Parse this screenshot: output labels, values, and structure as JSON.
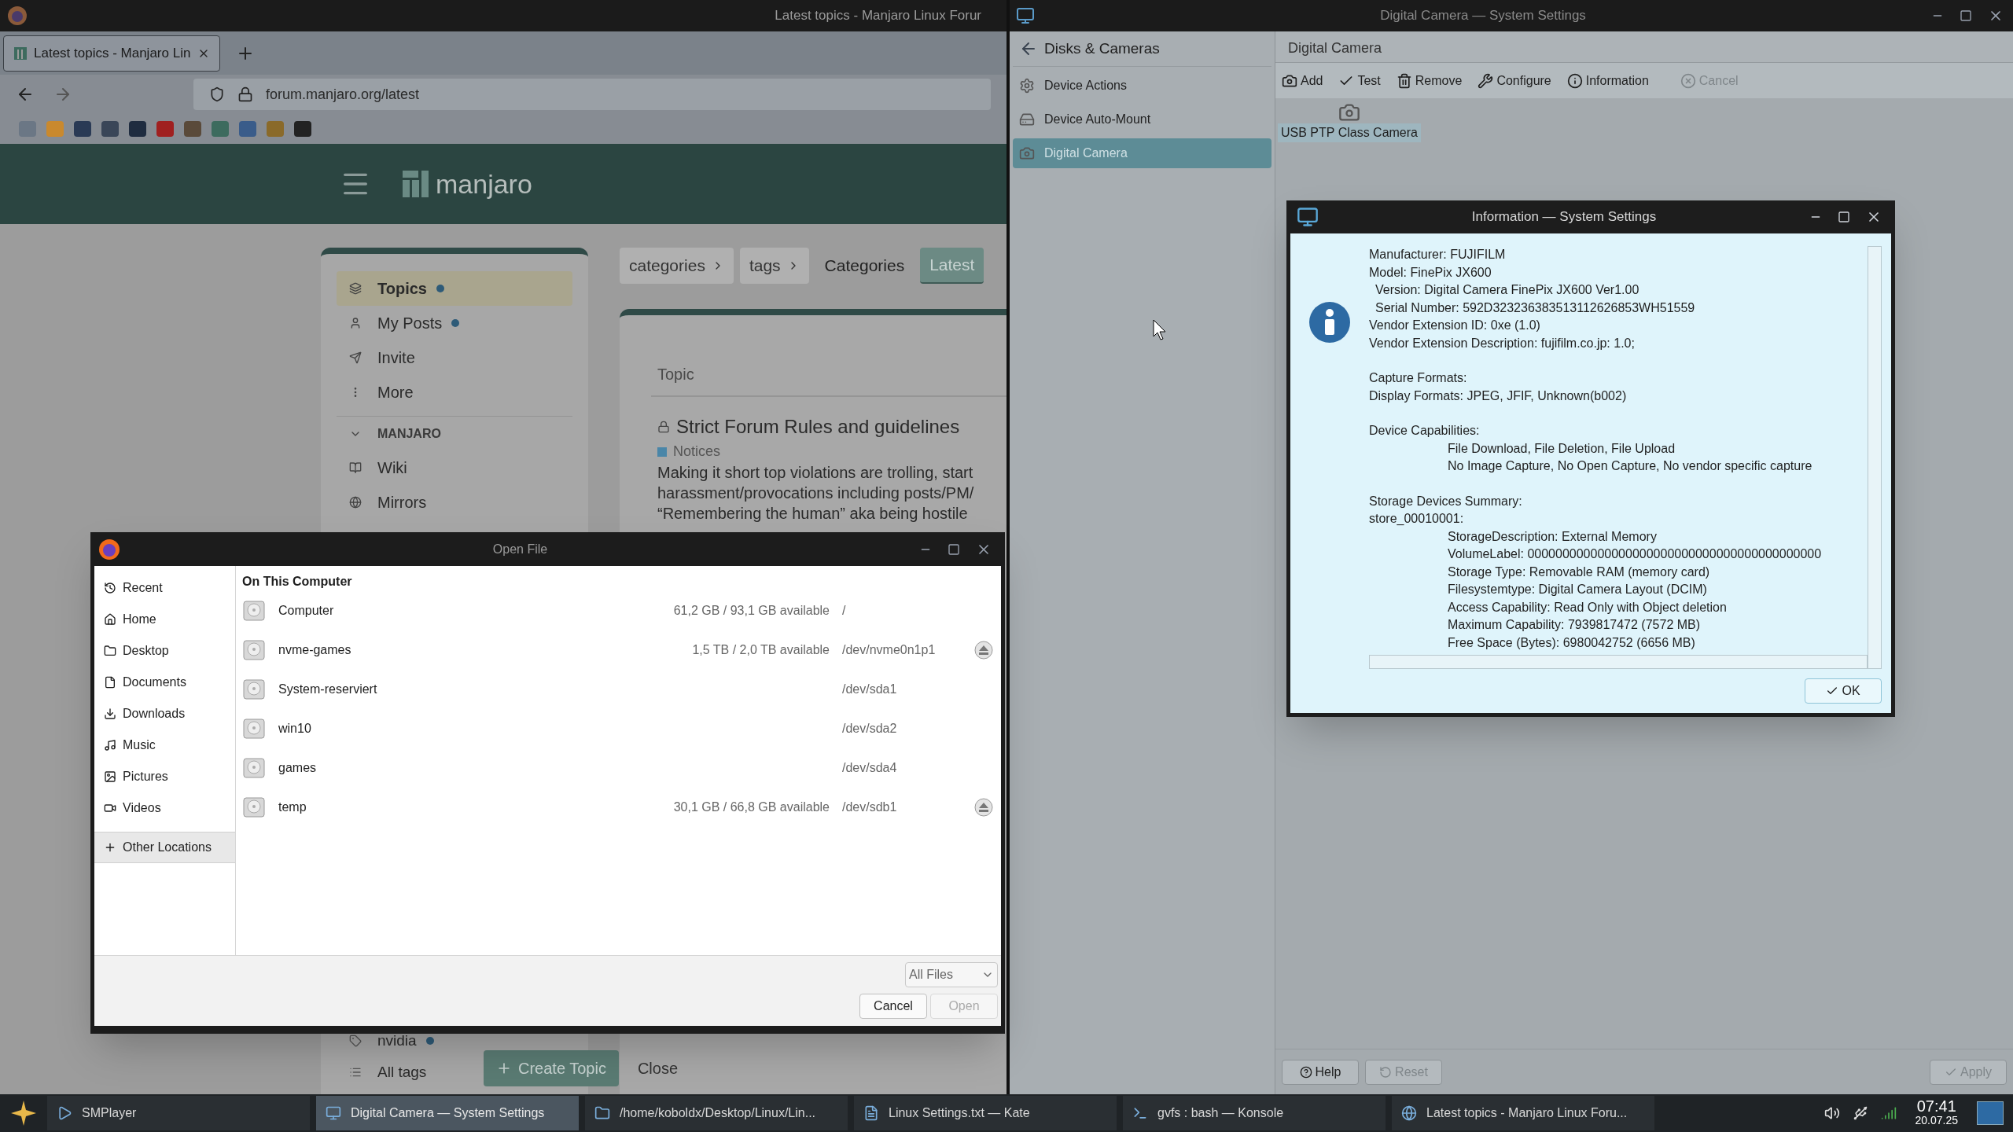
{
  "browser": {
    "title": "Latest topics - Manjaro Linux Forur",
    "tabs": [
      {
        "label": "Latest topics - Manjaro Lin",
        "selected": true
      }
    ],
    "url": "forum.manjaro.org/latest"
  },
  "forum": {
    "logo_text": "manjaro",
    "sidebar_top": [
      {
        "label": "Topics",
        "selected": true,
        "unread": true
      },
      {
        "label": "My Posts",
        "selected": false,
        "unread": true
      },
      {
        "label": "Invite",
        "selected": false,
        "unread": false
      },
      {
        "label": "More",
        "selected": false,
        "unread": false
      }
    ],
    "section": "MANJARO",
    "section_items": [
      {
        "label": "Wiki",
        "unread": false
      },
      {
        "label": "Mirrors",
        "unread": false
      }
    ],
    "sidebar_bottom": [
      {
        "label": "nvidia",
        "unread": true
      },
      {
        "label": "All tags",
        "unread": false
      }
    ],
    "filters": [
      {
        "label": "categories",
        "kind": "dropdown",
        "selected": false
      },
      {
        "label": "tags",
        "kind": "dropdown",
        "selected": false
      },
      {
        "label": "Categories",
        "kind": "link",
        "selected": false
      },
      {
        "label": "Latest",
        "kind": "link",
        "selected": true
      }
    ],
    "column_header": "Topic",
    "topic": {
      "title": "Strict Forum Rules and guidelines",
      "category": {
        "label": "Notices",
        "color": "#4a86a8"
      },
      "excerpt": [
        "Making it short top violations are trolling, start",
        "harassment/provocations including posts/PM/",
        "“Remembering the human” aka being hostile"
      ]
    },
    "create_button": "Create Topic",
    "close_button": "Close"
  },
  "settings": {
    "title": "Digital Camera — System Settings",
    "back_label": "Disks & Cameras",
    "sidebar": [
      {
        "label": "Device Actions",
        "selected": false
      },
      {
        "label": "Device Auto-Mount",
        "selected": false
      },
      {
        "label": "Digital Camera",
        "selected": true
      }
    ],
    "page_title": "Digital Camera",
    "toolbar": [
      {
        "label": "Add",
        "disabled": false
      },
      {
        "label": "Test",
        "disabled": false
      },
      {
        "label": "Remove",
        "disabled": false
      },
      {
        "label": "Configure",
        "disabled": false
      },
      {
        "label": "Information",
        "disabled": false
      },
      {
        "label": "Cancel",
        "disabled": true
      }
    ],
    "devices": [
      {
        "label": "USB PTP Class Camera",
        "selected": true
      }
    ],
    "footer": [
      {
        "label": "Help",
        "disabled": false
      },
      {
        "label": "Reset",
        "disabled": true
      },
      {
        "label": "Apply",
        "disabled": true
      }
    ]
  },
  "info_dialog": {
    "title": "Information — System Settings",
    "sections": [
      {
        "lines": [
          {
            "text": "Manufacturer: FUJIFILM",
            "kind": "plain"
          },
          {
            "text": "Model: FinePix JX600",
            "kind": "plain"
          },
          {
            "text": "Version: Digital Camera FinePix JX600 Ver1.00",
            "kind": "shifted"
          },
          {
            "text": "Serial Number: 592D323236383513112626853WH51559",
            "kind": "shifted"
          },
          {
            "text": "Vendor Extension ID: 0xe (1.0)",
            "kind": "plain"
          },
          {
            "text": "Vendor Extension Description: fujifilm.co.jp: 1.0;",
            "kind": "plain"
          }
        ]
      },
      {
        "lines": [
          {
            "text": "Capture Formats:",
            "kind": "plain"
          },
          {
            "text": "Display Formats: JPEG, JFIF, Unknown(b002)",
            "kind": "plain"
          }
        ]
      },
      {
        "lines": [
          {
            "text": "Device Capabilities:",
            "kind": "plain"
          },
          {
            "text": "File Download, File Deletion, File Upload",
            "kind": "tabbed"
          },
          {
            "text": "No Image Capture, No Open Capture, No vendor specific capture",
            "kind": "tabbed"
          }
        ]
      },
      {
        "lines": [
          {
            "text": "Storage Devices Summary:",
            "kind": "plain"
          },
          {
            "text": "store_00010001:",
            "kind": "plain"
          },
          {
            "text": "StorageDescription: External Memory",
            "kind": "tabbed"
          },
          {
            "text": "VolumeLabel: 000000000000000000000000000000000000000000",
            "kind": "tabbed"
          },
          {
            "text": "Storage Type: Removable RAM (memory card)",
            "kind": "tabbed"
          },
          {
            "text": "Filesystemtype: Digital Camera Layout (DCIM)",
            "kind": "tabbed"
          },
          {
            "text": "Access Capability: Read Only with Object deletion",
            "kind": "tabbed"
          },
          {
            "text": "Maximum Capability: 7939817472 (7572 MB)",
            "kind": "tabbed"
          },
          {
            "text": "Free Space (Bytes): 6980042752 (6656 MB)",
            "kind": "tabbed"
          }
        ]
      }
    ],
    "ok_button": "OK"
  },
  "open_file": {
    "title": "Open File",
    "places": [
      {
        "label": "Recent",
        "selected": false
      },
      {
        "label": "Home",
        "selected": false
      },
      {
        "label": "Desktop",
        "selected": false
      },
      {
        "label": "Documents",
        "selected": false
      },
      {
        "label": "Downloads",
        "selected": false
      },
      {
        "label": "Music",
        "selected": false
      },
      {
        "label": "Pictures",
        "selected": false
      },
      {
        "label": "Videos",
        "selected": false
      },
      {
        "label": "Other Locations",
        "selected": true
      }
    ],
    "header": "On This Computer",
    "locations": [
      {
        "name": "Computer",
        "space": "61,2 GB / 93,1 GB available",
        "device": "/",
        "ejectable": false
      },
      {
        "name": "nvme-games",
        "space": "1,5 TB / 2,0 TB available",
        "device": "/dev/nvme0n1p1",
        "ejectable": true
      },
      {
        "name": "System-reserviert",
        "device": "/dev/sda1",
        "ejectable": false
      },
      {
        "name": "win10",
        "device": "/dev/sda2",
        "ejectable": false
      },
      {
        "name": "games",
        "device": "/dev/sda4",
        "ejectable": false
      },
      {
        "name": "temp",
        "space": "30,1 GB / 66,8 GB available",
        "device": "/dev/sdb1",
        "ejectable": true
      }
    ],
    "filter": "All Files",
    "buttons": [
      {
        "label": "Cancel",
        "disabled": false
      },
      {
        "label": "Open",
        "disabled": true
      }
    ]
  },
  "taskbar": {
    "tasks": [
      {
        "label": "SMPlayer",
        "selected": false
      },
      {
        "label": "Digital Camera — System Settings",
        "selected": true
      },
      {
        "label": "/home/koboldx/Desktop/Linux/Lin...",
        "selected": false
      },
      {
        "label": "Linux Settings.txt — Kate",
        "selected": false
      },
      {
        "label": "gvfs : bash — Konsole",
        "selected": false
      },
      {
        "label": "Latest topics - Manjaro Linux Foru...",
        "selected": false
      }
    ],
    "time": "07:41",
    "date": "20.07.25"
  }
}
